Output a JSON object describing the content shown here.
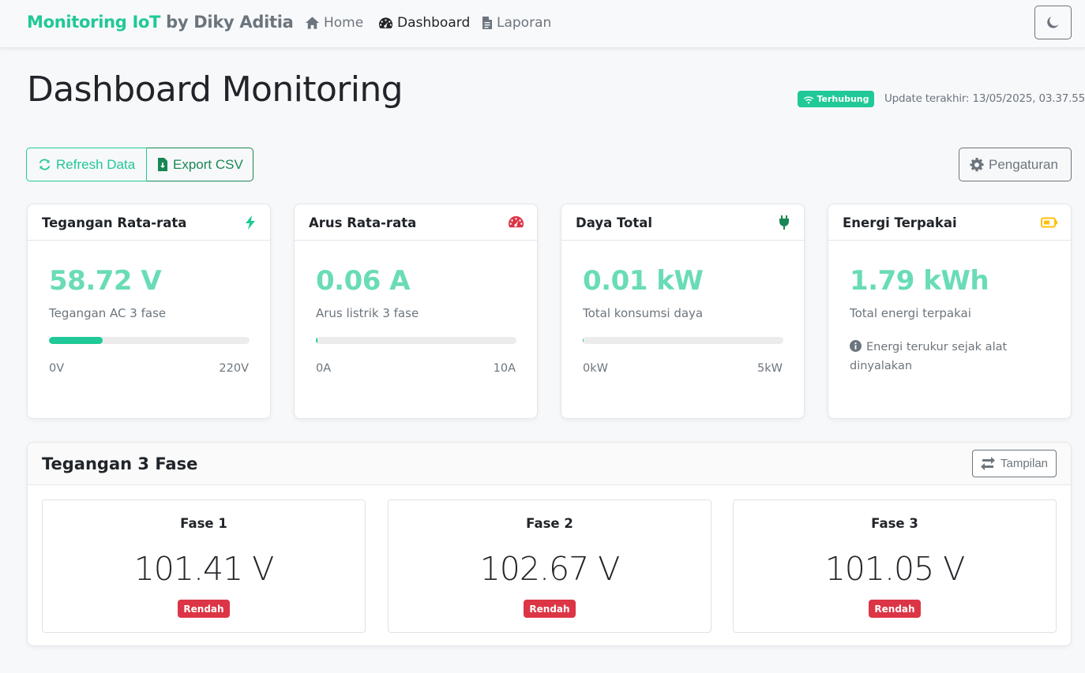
{
  "navbar": {
    "brand_primary": "Monitoring IoT",
    "brand_secondary": "by Diky Aditia",
    "links": [
      {
        "label": "Home",
        "icon": "home-icon",
        "active": false
      },
      {
        "label": "Dashboard",
        "icon": "dashboard-gauge-icon",
        "active": true
      },
      {
        "label": "Laporan",
        "icon": "document-icon",
        "active": false
      }
    ],
    "theme_toggle_icon": "moon-icon"
  },
  "header": {
    "title": "Dashboard Monitoring",
    "status_badge": "Terhubung",
    "last_update": "Update terakhir: 13/05/2025, 03.37.55"
  },
  "actions": {
    "refresh_label": "Refresh Data",
    "export_label": "Export CSV",
    "settings_label": "Pengaturan"
  },
  "cards": [
    {
      "title": "Tegangan Rata-rata",
      "icon": "bolt-icon",
      "value": "58.72 V",
      "description": "Tegangan AC 3 fase",
      "progress": 0.267,
      "min": "0V",
      "max": "220V"
    },
    {
      "title": "Arus Rata-rata",
      "icon": "speedometer-icon",
      "value": "0.06 A",
      "description": "Arus listrik 3 fase",
      "progress": 0.006,
      "min": "0A",
      "max": "10A"
    },
    {
      "title": "Daya Total",
      "icon": "plug-icon",
      "value": "0.01 kW",
      "description": "Total konsumsi daya",
      "progress": 0.002,
      "min": "0kW",
      "max": "5kW"
    },
    {
      "title": "Energi Terpakai",
      "icon": "battery-icon",
      "value": "1.79 kWh",
      "description": "Total energi terpakai",
      "note": "Energi terukur sejak alat dinyalakan"
    }
  ],
  "phases": {
    "title": "Tegangan 3 Fase",
    "view_button": "Tampilan",
    "items": [
      {
        "name": "Fase 1",
        "value": "101.41 V",
        "status": "Rendah"
      },
      {
        "name": "Fase 2",
        "value": "102.67 V",
        "status": "Rendah"
      },
      {
        "name": "Fase 3",
        "value": "101.05 V",
        "status": "Rendah"
      }
    ]
  },
  "colors": {
    "brand": "#20c997",
    "value_text": "#69dcb7",
    "success": "#198754",
    "danger": "#dc3545",
    "warning": "#ffc107",
    "muted": "#6c757d"
  }
}
